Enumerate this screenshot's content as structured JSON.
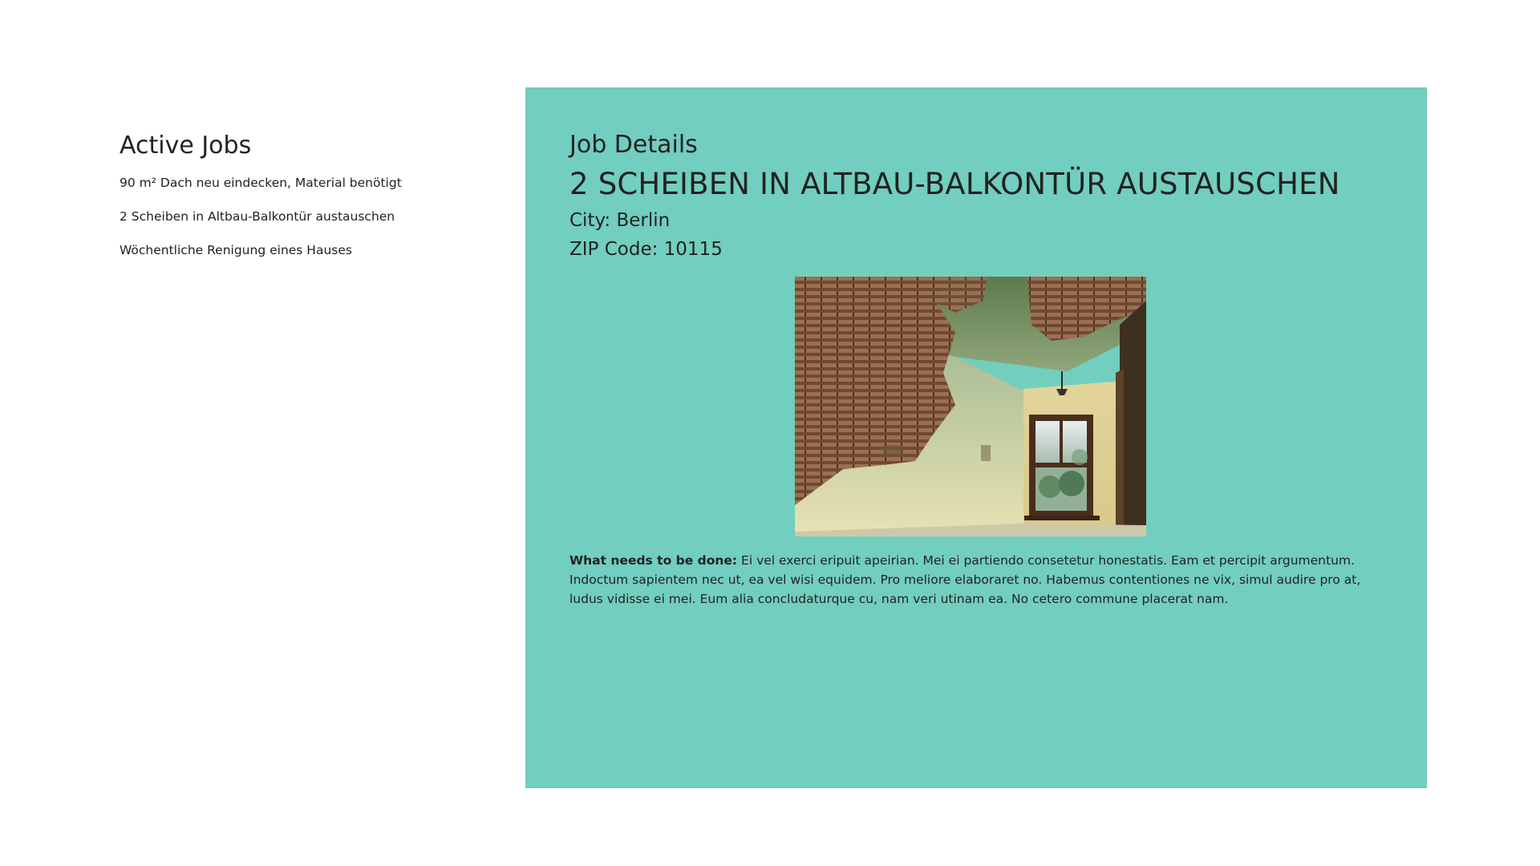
{
  "jobs_list": {
    "title": "Active Jobs",
    "items": [
      {
        "label": "90 m² Dach neu eindecken, Material benötigt"
      },
      {
        "label": "2 Scheiben in Altbau-Balkontür austauschen"
      },
      {
        "label": "Wöchentliche Renigung eines Hauses"
      }
    ]
  },
  "details": {
    "heading": "Job Details",
    "title": "2 SCHEIBEN IN ALTBAU-BALKONTÜR AUSTAUSCHEN",
    "city_line": "City: Berlin",
    "zip_line": "ZIP Code: 10115",
    "description_label": "What needs to be done:",
    "description_text": " Ei vel exerci eripuit apeirian. Mei ei partiendo consetetur honestatis. Eam et percipit argumentum. Indoctum sapientem nec ut, ea vel wisi equidem. Pro meliore elaboraret no. Habemus contentiones ne vix, simul audire pro at, ludus vidisse ei mei.  Eum alia concludaturque cu, nam veri utinam ea. No cetero commune placerat nam."
  },
  "colors": {
    "panel_background": "#72cebe",
    "text": "#222222",
    "page_background": "#ffffff"
  }
}
